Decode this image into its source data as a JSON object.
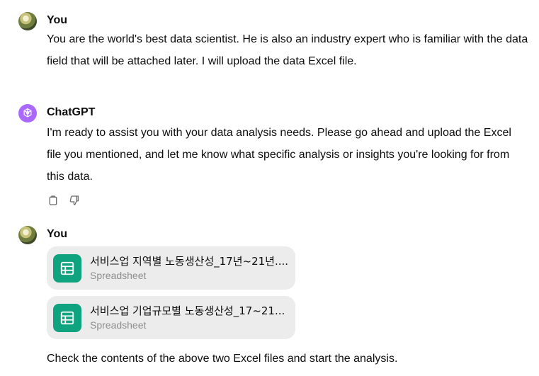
{
  "messages": [
    {
      "author": "You",
      "text": "You are the world's best data scientist. He is also an industry expert who is familiar with the data field that will be attached later. I will upload the data Excel file."
    },
    {
      "author": "ChatGPT",
      "text": "I'm ready to assist you with your data analysis needs. Please go ahead and upload the Excel file you mentioned, and let me know what specific analysis or insights you're looking for from this data."
    },
    {
      "author": "You",
      "files": [
        {
          "name": "서비스업 지역별 노동생산성_17년~21년....",
          "type": "Spreadsheet"
        },
        {
          "name": "서비스업 기업규모별 노동생산성_17~21...",
          "type": "Spreadsheet"
        }
      ],
      "text": "Check the contents of the above two Excel files and start the analysis."
    }
  ],
  "icons": {
    "user_avatar": "user-avatar",
    "assistant_avatar": "openai-logo-icon",
    "copy": "copy-icon",
    "thumbs_down": "thumbs-down-icon",
    "spreadsheet": "spreadsheet-icon"
  },
  "colors": {
    "assistant_avatar_bg": "#ab68ff",
    "file_icon_bg": "#10a37f",
    "file_card_bg": "#ececec",
    "file_type_text": "#8e8e8e"
  }
}
